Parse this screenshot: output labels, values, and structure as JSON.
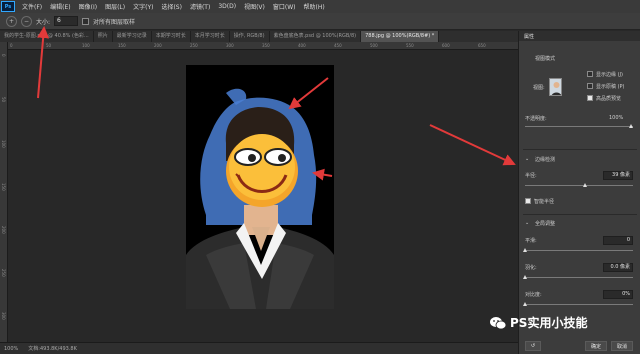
{
  "menubar": {
    "logo": "Ps",
    "items": [
      "文件(F)",
      "编辑(E)",
      "图像(I)",
      "图层(L)",
      "文字(Y)",
      "选择(S)",
      "滤镜(T)",
      "3D(D)",
      "视图(V)",
      "窗口(W)",
      "帮助(H)"
    ]
  },
  "options": {
    "size_label": "大小:",
    "size_value": "6",
    "sample_all_label": "对所有图层取样"
  },
  "tabs": [
    {
      "label": "我的学生-原图.psd @ 40.8% (色彩...",
      "active": false
    },
    {
      "label": "照片",
      "active": false
    },
    {
      "label": "最新学习记录",
      "active": false
    },
    {
      "label": "本期学习时长",
      "active": false
    },
    {
      "label": "本月学习时长",
      "active": false
    },
    {
      "label": "操作, RGB/8)",
      "active": false
    },
    {
      "label": "紫色盘底色表.psd @ 100%(RGB/8)",
      "active": false
    },
    {
      "label": "788.jpg @ 100%(RGB/8#) *",
      "active": true
    }
  ],
  "ruler": {
    "top": [
      "0",
      "50",
      "100",
      "150",
      "200",
      "250",
      "300",
      "350",
      "400",
      "450",
      "500",
      "550",
      "600",
      "650"
    ],
    "left": [
      "0",
      "50",
      "100",
      "150",
      "200",
      "250",
      "300"
    ]
  },
  "status": {
    "zoom": "100%",
    "doc": "文档:493.8K/493.8K"
  },
  "panel": {
    "title": "属性",
    "view_mode": "视图模式",
    "view_label": "视图:",
    "show_edge": "显示边缘 (J)",
    "show_original": "显示原稿 (P)",
    "high_quality_preview": "高品质预览",
    "opacity_label": "不透明度:",
    "opacity_value": "100%",
    "edge_detection": "边缘检测",
    "radius_label": "半径:",
    "radius_value": "39 像素",
    "smart_radius": "智能半径",
    "global_refine": "全局调整",
    "smooth_label": "平滑:",
    "smooth_value": "0",
    "feather_label": "羽化:",
    "feather_value": "0.0 像素",
    "contrast_label": "对比度:",
    "contrast_value": "0%",
    "ok_button": "确定",
    "cancel_icon": "取消"
  },
  "watermark": "PS实用小技能",
  "colors": {
    "arrow": "#e23a3a",
    "accent": "#31a8ff"
  }
}
